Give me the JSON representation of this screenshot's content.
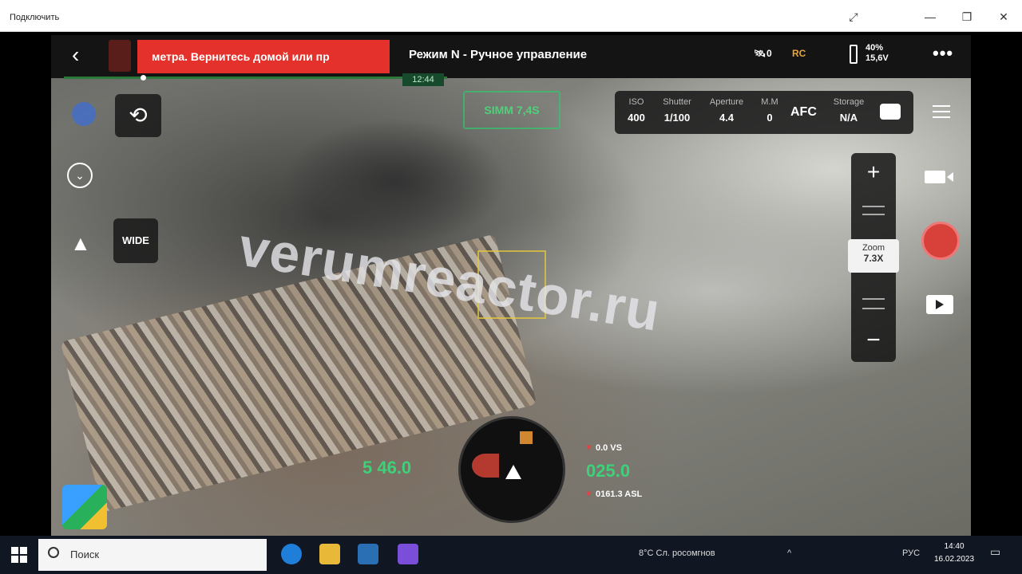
{
  "window": {
    "title": "Подключить"
  },
  "topbar": {
    "alert_text": "метра. Вернитесь домой или пр",
    "mode": "Режим N - Ручное управление",
    "satellites": "0",
    "rc_label": "RC",
    "battery_percent": "40%",
    "battery_voltage": "15,6V",
    "flight_time": "12:44"
  },
  "left_controls": {
    "wide_label": "WIDE"
  },
  "distance_box": {
    "text": "SIMM 7,4S"
  },
  "camera": {
    "iso_label": "ISO",
    "iso_value": "400",
    "shutter_label": "Shutter",
    "shutter_value": "1/100",
    "aperture_label": "Aperture",
    "aperture_value": "4.4",
    "mm_label": "M.M",
    "mm_value": "0",
    "afc": "AFC",
    "storage_label": "Storage",
    "storage_value": "N/A"
  },
  "zoom": {
    "label": "Zoom",
    "value": "7.3X"
  },
  "watermark": "verumreactor.ru",
  "telemetry": {
    "left_value": "5 46.0",
    "vs_text": "0.0 VS",
    "height_value": "025.0",
    "asl_text": "0161.3 ASL"
  },
  "taskbar": {
    "search_placeholder": "Поиск",
    "weather": "8°C Сл. росомгнов",
    "lang": "РУС",
    "time": "14:40",
    "date": "16.02.2023"
  },
  "colors": {
    "alert_red": "#e4312b",
    "telemetry_green": "#3fd07a",
    "rc_orange": "#e8a63a"
  }
}
